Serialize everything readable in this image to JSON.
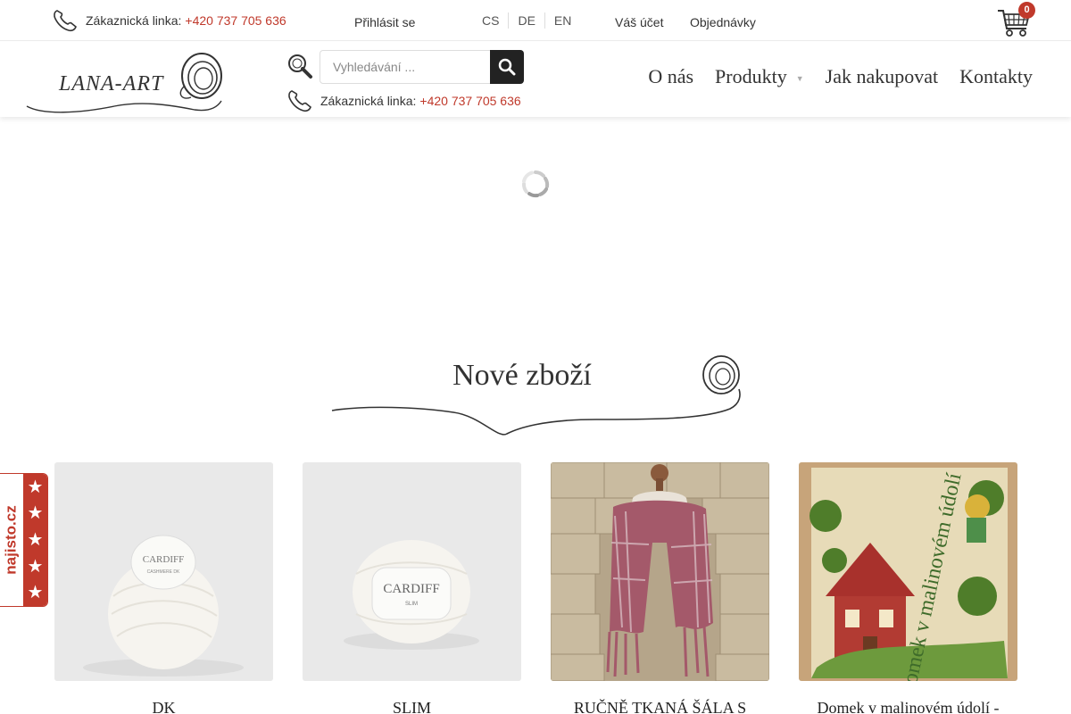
{
  "topbar": {
    "phone_label": "Zákaznická linka:",
    "phone_number": "+420 737 705 636",
    "login_label": " Přihlásit se",
    "languages": [
      "CS",
      "DE",
      "EN"
    ],
    "account_label": "Váš účet",
    "orders_label": "Objednávky",
    "cart_count": "0"
  },
  "header": {
    "logo_text": "LANA-ART",
    "search_placeholder": "Vyhledávání ...",
    "phone_label": "Zákaznická linka:",
    "phone_number": "+420 737 705 636",
    "nav": [
      {
        "label": "O nás"
      },
      {
        "label": "Produkty",
        "has_submenu": true
      },
      {
        "label": "Jak nakupovat"
      },
      {
        "label": "Kontakty"
      }
    ]
  },
  "section": {
    "title": "Nové zboží"
  },
  "products": [
    {
      "name": "DK",
      "brand_text": "CARDIFF",
      "sub_text": "CASHMERE DK"
    },
    {
      "name": "SLIM",
      "brand_text": "CARDIFF",
      "sub_text": "SLIM"
    },
    {
      "name": "RUČNĚ TKANÁ ŠÁLA S"
    },
    {
      "name": "Domek v malinovém údolí -",
      "cover_title": "Domek v malinovém údolí"
    }
  ],
  "badge": {
    "text": "najisto.cz",
    "stars": 5
  },
  "colors": {
    "accent": "#c0392b",
    "dark": "#222222",
    "text": "#333333"
  }
}
